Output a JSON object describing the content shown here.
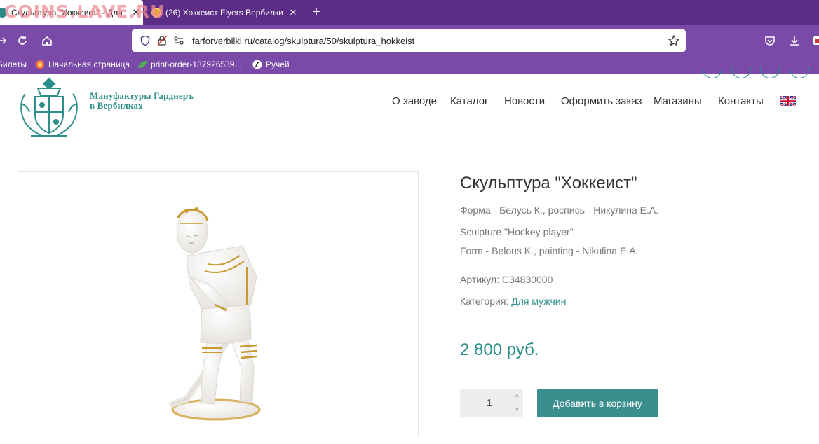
{
  "browser": {
    "watermark": "COINS.LAVE.RU",
    "tabs": [
      {
        "title": "Скульптура \"Хоккеист\" - Для",
        "active": true
      },
      {
        "title": "(26) Хоккеист Flyers Вербилки",
        "active": false
      }
    ],
    "url": "farforverbilki.ru/catalog/skulptura/50/skulptura_hokkeist",
    "bookmarks": [
      "Билеты",
      "Начальная страница",
      "print-order-137926539...",
      "Ручей"
    ]
  },
  "site": {
    "brand_line1": "Мануфактуры Гарднеръ",
    "brand_line2": "в Вербилках",
    "menu": [
      "О заводе",
      "Каталог",
      "Новости",
      "Оформить заказ",
      "Магазины",
      "Контакты"
    ],
    "active_menu": "Каталог",
    "accent_color": "#2d8f8a"
  },
  "product": {
    "title": "Скульптура \"Хоккеист\"",
    "form_ru": "Форма - Белусь К., роспись - Никулина Е.А.",
    "title_en": "Sculpture \"Hockey player\"",
    "form_en": "Form - Belous K., painting - Nikulina E.A.",
    "sku_label": "Артикул:",
    "sku": "С34830000",
    "category_label": "Категория:",
    "category": "Для мужчин",
    "price": "2 800 руб.",
    "quantity": "1",
    "add_to_cart": "Добавить в корзину"
  }
}
